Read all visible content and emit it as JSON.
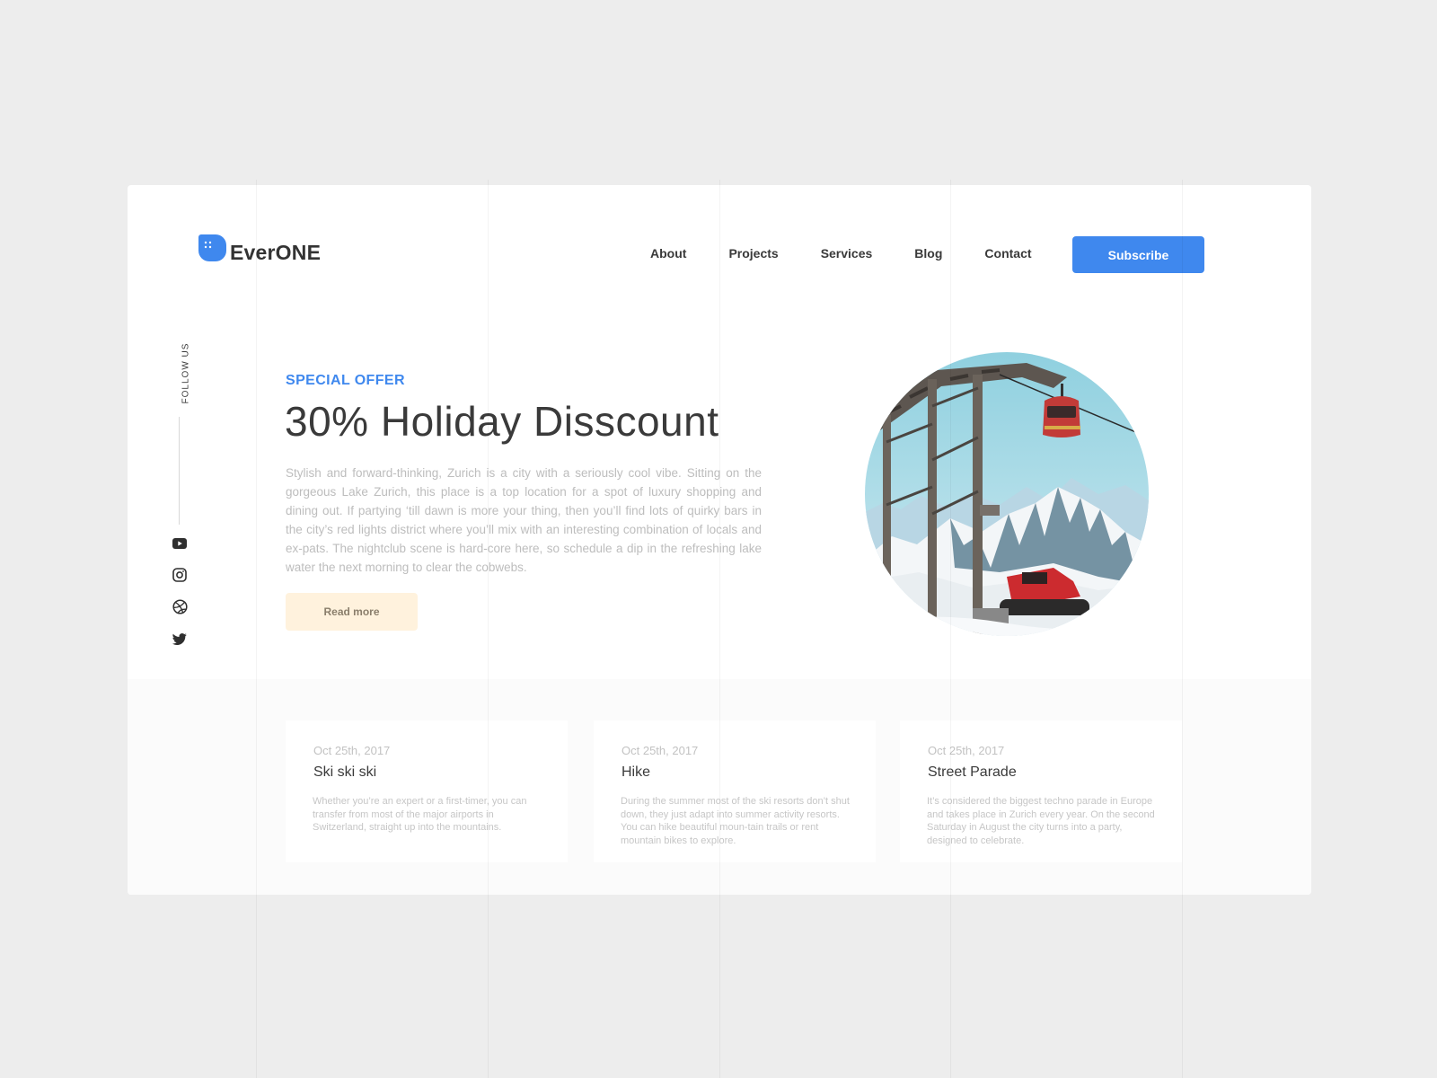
{
  "brand": {
    "name": "EverONE",
    "accent_color": "#3f88ee"
  },
  "nav": {
    "items": [
      {
        "label": "About"
      },
      {
        "label": "Projects"
      },
      {
        "label": "Services"
      },
      {
        "label": "Blog"
      },
      {
        "label": "Contact"
      }
    ],
    "subscribe_label": "Subscribe"
  },
  "social": {
    "follow_label": "FOLLOW US",
    "icons": [
      "youtube-icon",
      "instagram-icon",
      "dribbble-icon",
      "twitter-icon"
    ]
  },
  "hero": {
    "eyebrow": "SPECIAL OFFER",
    "headline": "30% Holiday Disscount",
    "body": "Stylish and forward-thinking, Zurich is a city with a seriously cool vibe. Sitting on the gorgeous Lake Zurich, this place is a top location for a spot of luxury shopping and dining out. If partying ‘till dawn is more your thing, then you’ll find lots of quirky bars in the city’s red lights district where you’ll mix with an interesting combination of locals and ex-pats. The nightclub scene is hard-core here, so schedule a dip in the refreshing lake water the next morning to clear the cobwebs.",
    "cta_label": "Read more",
    "cta_color": "#fff2dd"
  },
  "events": [
    {
      "date": "Oct 25th, 2017",
      "title": "Ski ski ski",
      "description": "Whether you’re an expert or a first-timer, you can transfer from most of the major airports in Switzerland, straight up into the mountains."
    },
    {
      "date": "Oct 25th, 2017",
      "title": "Hike",
      "description": "During the summer most of the ski resorts don’t shut down, they just adapt into summer activity resorts. You can hike beautiful moun-tain trails or rent mountain bikes to explore."
    },
    {
      "date": "Oct 25th, 2017",
      "title": "Street Parade",
      "description": "It’s considered the biggest techno parade in Europe and takes place in Zurich every year. On the second Saturday in August the city turns into a party, designed to celebrate."
    }
  ]
}
